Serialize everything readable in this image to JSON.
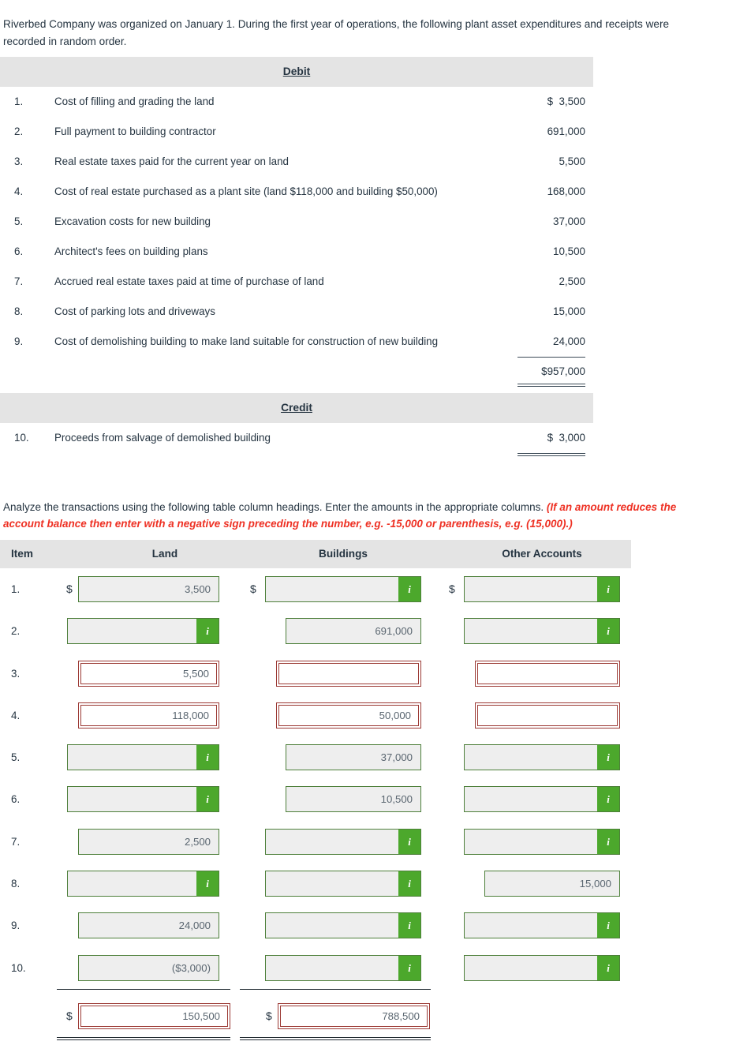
{
  "intro": "Riverbed Company was organized on January 1. During the first year of operations, the following plant asset expenditures and receipts were recorded in random order.",
  "listing": {
    "debit_header": "Debit",
    "credit_header": "Credit",
    "debit_rows": [
      {
        "num": "1.",
        "desc": "Cost of filling and grading the land",
        "amount": "$  3,500"
      },
      {
        "num": "2.",
        "desc": "Full payment to building contractor",
        "amount": "691,000"
      },
      {
        "num": "3.",
        "desc": "Real estate taxes paid for the current year on land",
        "amount": "5,500"
      },
      {
        "num": "4.",
        "desc": "Cost of real estate purchased as a plant site (land $118,000 and building $50,000)",
        "amount": "168,000"
      },
      {
        "num": "5.",
        "desc": "Excavation costs for new building",
        "amount": "37,000"
      },
      {
        "num": "6.",
        "desc": "Architect's fees on building plans",
        "amount": "10,500"
      },
      {
        "num": "7.",
        "desc": "Accrued real estate taxes paid at time of purchase of land",
        "amount": "2,500"
      },
      {
        "num": "8.",
        "desc": "Cost of parking lots and driveways",
        "amount": "15,000"
      },
      {
        "num": "9.",
        "desc": "Cost of demolishing building to make land suitable for construction of new building",
        "amount": "24,000"
      }
    ],
    "debit_total": "$957,000",
    "credit_rows": [
      {
        "num": "10.",
        "desc": "Proceeds from salvage of demolished building",
        "amount": "$  3,000"
      }
    ]
  },
  "analyze": {
    "text": "Analyze the transactions using the following table column headings. Enter the amounts in the appropriate columns. ",
    "warning": "(If an amount reduces the account balance then enter with a negative sign preceding the number, e.g. -15,000 or parenthesis, e.g. (15,000).)"
  },
  "worksheet": {
    "headers": {
      "item": "Item",
      "land": "Land",
      "buildings": "Buildings",
      "other": "Other Accounts"
    },
    "rows": [
      {
        "num": "1.",
        "land": {
          "value": "3,500",
          "style": "green",
          "info": false,
          "dollar": "$"
        },
        "buildings": {
          "value": "",
          "style": "green",
          "info": true,
          "dollar": "$"
        },
        "other": {
          "value": "",
          "style": "green",
          "info": true,
          "dollar": "$"
        }
      },
      {
        "num": "2.",
        "land": {
          "value": "",
          "style": "green",
          "info": true,
          "dollar": ""
        },
        "buildings": {
          "value": "691,000",
          "style": "green",
          "info": false,
          "dollar": ""
        },
        "other": {
          "value": "",
          "style": "green",
          "info": true,
          "dollar": ""
        }
      },
      {
        "num": "3.",
        "land": {
          "value": "5,500",
          "style": "red",
          "info": false,
          "dollar": ""
        },
        "buildings": {
          "value": "",
          "style": "red",
          "info": false,
          "dollar": ""
        },
        "other": {
          "value": "",
          "style": "red",
          "info": false,
          "dollar": ""
        }
      },
      {
        "num": "4.",
        "land": {
          "value": "118,000",
          "style": "red",
          "info": false,
          "dollar": ""
        },
        "buildings": {
          "value": "50,000",
          "style": "red",
          "info": false,
          "dollar": ""
        },
        "other": {
          "value": "",
          "style": "red",
          "info": false,
          "dollar": ""
        }
      },
      {
        "num": "5.",
        "land": {
          "value": "",
          "style": "green",
          "info": true,
          "dollar": ""
        },
        "buildings": {
          "value": "37,000",
          "style": "green",
          "info": false,
          "dollar": ""
        },
        "other": {
          "value": "",
          "style": "green",
          "info": true,
          "dollar": ""
        }
      },
      {
        "num": "6.",
        "land": {
          "value": "",
          "style": "green",
          "info": true,
          "dollar": ""
        },
        "buildings": {
          "value": "10,500",
          "style": "green",
          "info": false,
          "dollar": ""
        },
        "other": {
          "value": "",
          "style": "green",
          "info": true,
          "dollar": ""
        }
      },
      {
        "num": "7.",
        "land": {
          "value": "2,500",
          "style": "green",
          "info": false,
          "dollar": ""
        },
        "buildings": {
          "value": "",
          "style": "green",
          "info": true,
          "dollar": ""
        },
        "other": {
          "value": "",
          "style": "green",
          "info": true,
          "dollar": ""
        }
      },
      {
        "num": "8.",
        "land": {
          "value": "",
          "style": "green",
          "info": true,
          "dollar": ""
        },
        "buildings": {
          "value": "",
          "style": "green",
          "info": true,
          "dollar": ""
        },
        "other": {
          "value": "15,000",
          "style": "green",
          "info": false,
          "dollar": ""
        }
      },
      {
        "num": "9.",
        "land": {
          "value": "24,000",
          "style": "green",
          "info": false,
          "dollar": ""
        },
        "buildings": {
          "value": "",
          "style": "green",
          "info": true,
          "dollar": ""
        },
        "other": {
          "value": "",
          "style": "green",
          "info": true,
          "dollar": ""
        }
      },
      {
        "num": "10.",
        "land": {
          "value": "($3,000)",
          "style": "green",
          "info": false,
          "dollar": ""
        },
        "buildings": {
          "value": "",
          "style": "green",
          "info": true,
          "dollar": ""
        },
        "other": {
          "value": "",
          "style": "green",
          "info": true,
          "dollar": ""
        }
      }
    ],
    "totals": {
      "land": {
        "value": "150,500",
        "style": "red",
        "dollar": "$"
      },
      "buildings": {
        "value": "788,500",
        "style": "red",
        "dollar": "$"
      }
    }
  },
  "colors": {
    "band": "#e4e4e4",
    "input_green_border": "#4d7f3a",
    "info_badge_green": "#4ca82c",
    "input_red_border": "#9c3a35",
    "warning_red": "#ee3124",
    "text": "#253441"
  }
}
